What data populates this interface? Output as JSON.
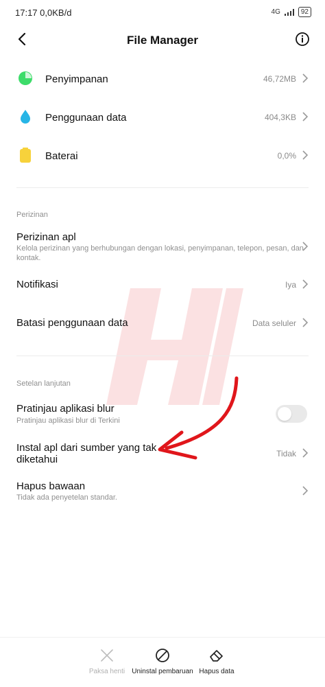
{
  "status_bar": {
    "time": "17:17",
    "speed": "0,0KB/d",
    "network": "4G",
    "battery": "92"
  },
  "header": {
    "title": "File Manager",
    "back_icon": "back-arrow-icon",
    "info_icon": "info-icon"
  },
  "usage_rows": [
    {
      "label": "Penyimpanan",
      "value": "46,72MB",
      "icon": "storage-pie-icon",
      "color": "#3ddc6a"
    },
    {
      "label": "Penggunaan data",
      "value": "404,3KB",
      "icon": "water-drop-icon",
      "color": "#27b5e6"
    },
    {
      "label": "Baterai",
      "value": "0,0%",
      "icon": "battery-icon",
      "color": "#f7d23b"
    }
  ],
  "permissions": {
    "section_title": "Perizinan",
    "app_permissions": {
      "label": "Perizinan apl",
      "desc_line1": "Kelola perizinan yang berhubungan dengan lokasi, penyimpanan, telepon, pesan, dan",
      "desc_line2": "kontak."
    },
    "notifications": {
      "label": "Notifikasi",
      "value": "Iya"
    },
    "data_limit": {
      "label": "Batasi penggunaan data",
      "value": "Data seluler"
    }
  },
  "advanced": {
    "section_title": "Setelan lanjutan",
    "blur_preview": {
      "label": "Pratinjau aplikasi blur",
      "desc": "Pratinjau aplikasi blur di Terkini",
      "enabled": false
    },
    "unknown_sources": {
      "label_line1": "Instal apl dari sumber yang tak",
      "label_line2": "diketahui",
      "value": "Tidak"
    },
    "clear_defaults": {
      "label": "Hapus bawaan",
      "desc": "Tidak ada penyetelan standar."
    }
  },
  "bottom_bar": [
    {
      "label": "Paksa henti",
      "icon": "close-x-icon",
      "enabled": false
    },
    {
      "label": "Uninstal pembaruan",
      "icon": "block-circle-icon",
      "enabled": true
    },
    {
      "label": "Hapus data",
      "icon": "eraser-icon",
      "enabled": true
    }
  ],
  "accent": {
    "arrow_color": "#e0161b",
    "watermark_color": "#e0161b"
  }
}
